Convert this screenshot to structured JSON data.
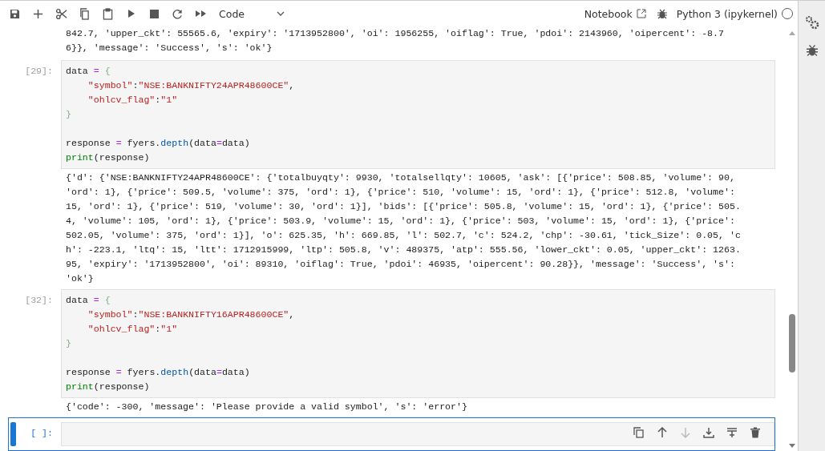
{
  "toolbar": {
    "buttons": [
      {
        "kind": "save"
      },
      {
        "kind": "add"
      },
      {
        "kind": "cut"
      },
      {
        "kind": "copy"
      },
      {
        "kind": "paste"
      },
      {
        "kind": "run"
      },
      {
        "kind": "stop"
      },
      {
        "kind": "restart"
      },
      {
        "kind": "run-all"
      }
    ],
    "cell_type": "Code",
    "notebook_link": "Notebook",
    "kernel": "Python 3 (ipykernel)",
    "kernel_busy": false
  },
  "cells": [
    {
      "kind": "output-only",
      "output": [
        "842.7, 'upper_ckt': 55565.6, 'expiry': '1713952800', 'oi': 1956255, 'oiflag': True, 'pdoi': 2143960, 'oipercent': -8.7",
        "6}}, 'message': 'Success', 's': 'ok'}"
      ]
    },
    {
      "kind": "code",
      "prompt": "[29]:",
      "active": false,
      "code_blocks": [
        [
          {
            "tokens": [
              {
                "text": "data",
                "kind": "plain"
              },
              {
                "text": "=",
                "kind": "op"
              },
              {
                "text": "{",
                "kind": "brace"
              }
            ]
          },
          {
            "tokens": [
              {
                "text": "    \"symbol\"",
                "kind": "string"
              },
              {
                "text": ":",
                "kind": "plain"
              },
              {
                "text": "\"NSE:BANKNIFTY24APR48600CE\"",
                "kind": "string"
              },
              {
                "text": ",",
                "kind": "plain"
              }
            ]
          },
          {
            "tokens": [
              {
                "text": "    \"ohlcv_flag\"",
                "kind": "string"
              },
              {
                "text": ":",
                "kind": "plain"
              },
              {
                "text": "\"1\"",
                "kind": "string"
              }
            ]
          },
          {
            "tokens": [
              {
                "text": "}",
                "kind": "brace"
              }
            ]
          }
        ],
        [
          {
            "tokens": [
              {
                "text": "response",
                "kind": "plain"
              },
              {
                "text": "=",
                "kind": "op"
              },
              {
                "text": "fyers.",
                "kind": "plain"
              },
              {
                "text": "depth",
                "kind": "attr"
              },
              {
                "text": "(data",
                "kind": "plain"
              },
              {
                "text": "=",
                "kind": "op"
              },
              {
                "text": "data)",
                "kind": "plain"
              }
            ]
          },
          {
            "tokens": [
              {
                "text": "print",
                "kind": "builtin"
              },
              {
                "text": "(response)",
                "kind": "plain"
              }
            ]
          }
        ]
      ],
      "output": [
        "{'d': {'NSE:BANKNIFTY24APR48600CE': {'totalbuyqty': 9930, 'totalsellqty': 10605, 'ask': [{'price': 508.85, 'volume': 90,",
        "'ord': 1}, {'price': 509.5, 'volume': 375, 'ord': 1}, {'price': 510, 'volume': 15, 'ord': 1}, {'price': 512.8, 'volume':",
        "15, 'ord': 1}, {'price': 519, 'volume': 30, 'ord': 1}], 'bids': [{'price': 505.8, 'volume': 15, 'ord': 1}, {'price': 505.",
        "4, 'volume': 105, 'ord': 1}, {'price': 503.9, 'volume': 15, 'ord': 1}, {'price': 503, 'volume': 15, 'ord': 1}, {'price':",
        "502.05, 'volume': 375, 'ord': 1}], 'o': 625.35, 'h': 669.85, 'l': 502.7, 'c': 524.2, 'chp': -30.61, 'tick_Size': 0.05, 'c",
        "h': -223.1, 'ltq': 15, 'ltt': 1712915999, 'ltp': 505.8, 'v': 489375, 'atp': 555.56, 'lower_ckt': 0.05, 'upper_ckt': 1263.",
        "95, 'expiry': '1713952800', 'oi': 89310, 'oiflag': True, 'pdoi': 46935, 'oipercent': 90.28}}, 'message': 'Success', 's':",
        "'ok'}"
      ]
    },
    {
      "kind": "code",
      "prompt": "[32]:",
      "active": false,
      "code_blocks": [
        [
          {
            "tokens": [
              {
                "text": "data",
                "kind": "plain"
              },
              {
                "text": "=",
                "kind": "op"
              },
              {
                "text": "{",
                "kind": "brace"
              }
            ]
          },
          {
            "tokens": [
              {
                "text": "    \"symbol\"",
                "kind": "string"
              },
              {
                "text": ":",
                "kind": "plain"
              },
              {
                "text": "\"NSE:BANKNIFTY16APR48600CE\"",
                "kind": "string"
              },
              {
                "text": ",",
                "kind": "plain"
              }
            ]
          },
          {
            "tokens": [
              {
                "text": "    \"ohlcv_flag\"",
                "kind": "string"
              },
              {
                "text": ":",
                "kind": "plain"
              },
              {
                "text": "\"1\"",
                "kind": "string"
              }
            ]
          },
          {
            "tokens": [
              {
                "text": "}",
                "kind": "brace"
              }
            ]
          }
        ],
        [
          {
            "tokens": [
              {
                "text": "response",
                "kind": "plain"
              },
              {
                "text": "=",
                "kind": "op"
              },
              {
                "text": "fyers.",
                "kind": "plain"
              },
              {
                "text": "depth",
                "kind": "attr"
              },
              {
                "text": "(data",
                "kind": "plain"
              },
              {
                "text": "=",
                "kind": "op"
              },
              {
                "text": "data)",
                "kind": "plain"
              }
            ]
          },
          {
            "tokens": [
              {
                "text": "print",
                "kind": "builtin"
              },
              {
                "text": "(response)",
                "kind": "plain"
              }
            ]
          }
        ]
      ],
      "output": [
        "{'code': -300, 'message': 'Please provide a valid symbol', 's': 'error'}"
      ]
    },
    {
      "kind": "code",
      "prompt": "[ ]:",
      "active": true,
      "cell_tools": [
        {
          "kind": "duplicate",
          "disabled": false
        },
        {
          "kind": "up",
          "disabled": false
        },
        {
          "kind": "down",
          "disabled": true
        },
        {
          "kind": "insert-above",
          "disabled": false
        },
        {
          "kind": "insert-below",
          "disabled": false
        },
        {
          "kind": "delete",
          "disabled": false
        }
      ]
    }
  ]
}
